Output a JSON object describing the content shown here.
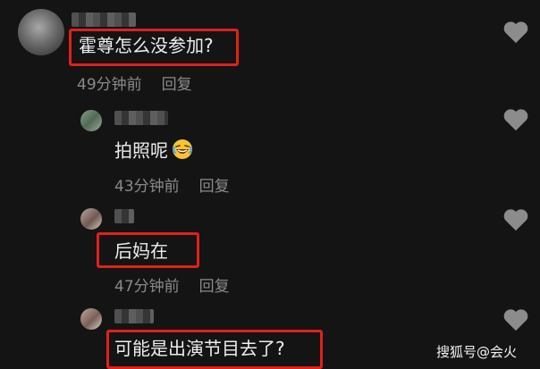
{
  "comments": [
    {
      "text": "霍尊怎么没参加?",
      "time": "49分钟前",
      "reply_label": "回复"
    },
    {
      "text": "拍照呢",
      "time": "43分钟前",
      "reply_label": "回复"
    },
    {
      "text": "后妈在",
      "time": "47分钟前",
      "reply_label": "回复"
    },
    {
      "text": "可能是出演节目去了?"
    }
  ],
  "watermark": "搜狐号@会火",
  "colors": {
    "background": "#141414",
    "highlight": "#e0201c",
    "meta": "#8a8a8a",
    "text": "#ededed"
  },
  "icons": [
    "heart-icon",
    "laughing-emoji-icon"
  ]
}
